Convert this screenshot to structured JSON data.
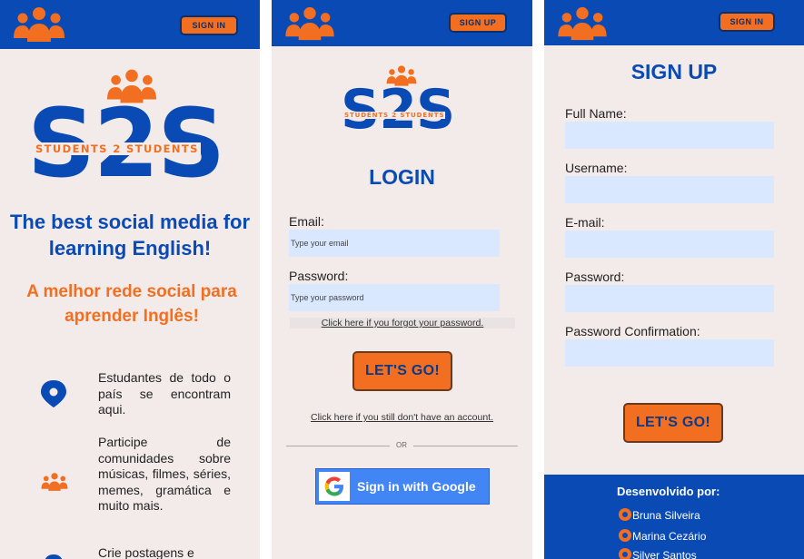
{
  "colors": {
    "blue": "#0a4ab4",
    "orange": "#f26f21",
    "background": "#f2ebe9",
    "input": "#d9e8ff"
  },
  "brand": {
    "logo_text": "S2S",
    "tagline": "STUDENTS 2 STUDENTS",
    "icon": "people-group-icon"
  },
  "home": {
    "nav_button": "SIGN IN",
    "headline_en": "The best social media for learning English!",
    "headline_pt": "A melhor rede social para aprender Inglês!",
    "features": [
      {
        "icon": "location-pin-icon",
        "text": "Estudantes de todo o país se encontram aqui."
      },
      {
        "icon": "people-group-icon",
        "text": "Participe de comunidades sobre músicas, filmes, séries, memes, gramática e muito mais."
      },
      {
        "icon": "location-pin-icon",
        "text": "Crie postagens e"
      }
    ]
  },
  "login": {
    "nav_button": "SIGN UP",
    "title": "LOGIN",
    "email_label": "Email:",
    "email_placeholder": "Type your email",
    "password_label": "Password:",
    "password_placeholder": "Type your password",
    "forgot_link": "Click here if you forgot your password.",
    "submit": "LET'S GO!",
    "signup_link": "Click here if you still don't have an account.",
    "divider": "OR",
    "google_button": "Sign in with Google"
  },
  "signup": {
    "nav_button": "SIGN IN",
    "title": "SIGN UP",
    "fields": [
      {
        "label": "Full Name:"
      },
      {
        "label": "Username:"
      },
      {
        "label": "E-mail:"
      },
      {
        "label": "Password:"
      },
      {
        "label": "Password Confirmation:"
      }
    ],
    "submit": "LET'S GO!",
    "footer_title": "Desenvolvido por:",
    "developers": [
      "Bruna Silveira",
      "Marina Cezário",
      "Silver Santos"
    ]
  }
}
